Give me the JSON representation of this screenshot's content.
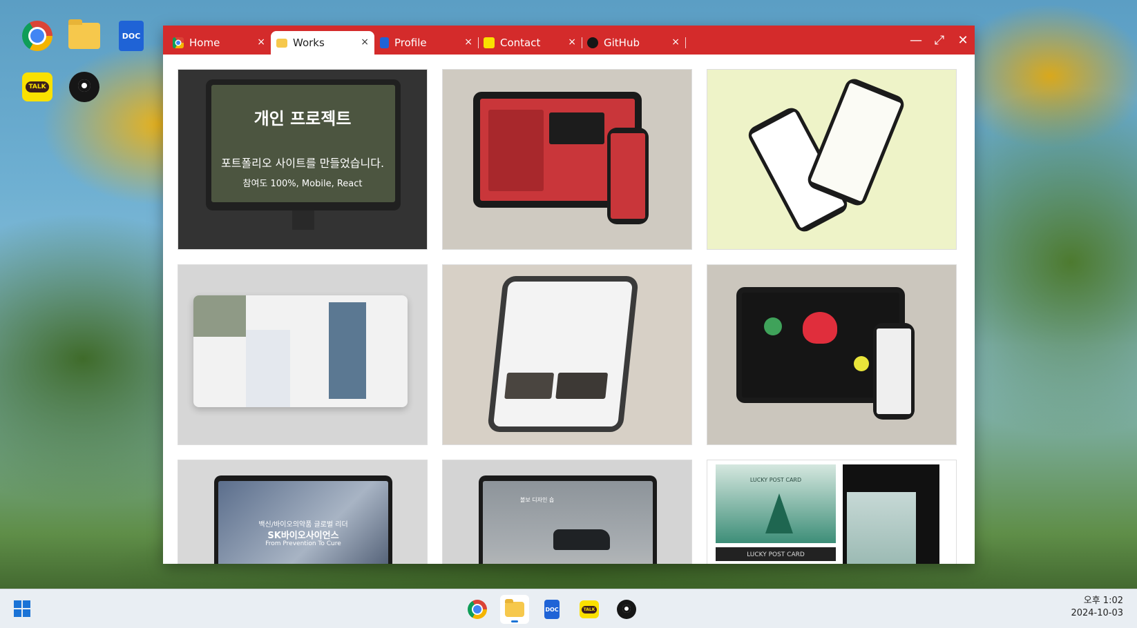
{
  "desktop": {
    "icons": [
      {
        "name": "chrome-icon"
      },
      {
        "name": "folder-icon"
      },
      {
        "name": "doc-icon",
        "label": "DOC"
      },
      {
        "name": "kakaotalk-icon",
        "label": "TALK"
      },
      {
        "name": "github-icon"
      }
    ]
  },
  "window": {
    "tabs": [
      {
        "label": "Home",
        "icon": "chrome-icon"
      },
      {
        "label": "Works",
        "icon": "folder-icon",
        "active": true
      },
      {
        "label": "Profile",
        "icon": "doc-icon"
      },
      {
        "label": "Contact",
        "icon": "kakaotalk-icon"
      },
      {
        "label": "GitHub",
        "icon": "github-icon"
      }
    ],
    "tab_close": "×",
    "controls": {
      "minimize": "—",
      "maximize": "⤢",
      "close": "✕"
    },
    "accent": "#d42b2b"
  },
  "works": {
    "card1": {
      "title": "개인 프로젝트",
      "description": "포트폴리오 사이트를 만들었습니다.",
      "sub": "참여도 100%, Mobile, React"
    },
    "card7": {
      "headline": "백신/바이오의약품 글로벌 리더",
      "title": "SK바이오사이언스",
      "sub": "From Prevention To Cure"
    },
    "card8": {
      "headline": "볼보 디자인 숍"
    },
    "card9": {
      "label_top": "LUCKY POST CARD",
      "label_bottom": "LUCKY POST CARD"
    }
  },
  "taskbar": {
    "doc_label": "DOC",
    "talk_label": "TALK",
    "time": "오후 1:02",
    "date": "2024-10-03"
  }
}
